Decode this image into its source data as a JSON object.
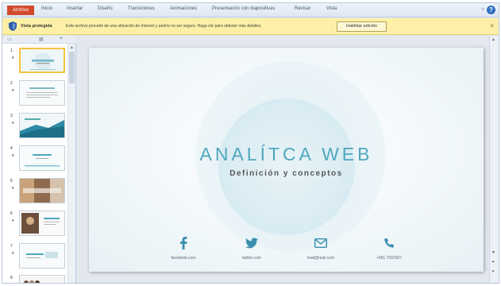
{
  "ribbon": {
    "file_tab": "Archivo",
    "tabs": [
      "Inicio",
      "Insertar",
      "Diseño",
      "Transiciones",
      "Animaciones",
      "Presentación con diapositivas",
      "Revisar",
      "Vista"
    ]
  },
  "protected_view": {
    "title": "Vista protegida",
    "message": "Este archivo procede de una ubicación de Internet y podría no ser seguro. Haga clic para obtener más detalles.",
    "button_label": "Habilitar edición"
  },
  "thumbnails": {
    "slide_numbers": [
      "1",
      "2",
      "3",
      "4",
      "5",
      "6",
      "7",
      "8"
    ]
  },
  "slide": {
    "title": "ANALÍTCA WEB",
    "subtitle": "Definición y conceptos",
    "contacts": [
      {
        "icon": "facebook-icon",
        "label": "facebook.com"
      },
      {
        "icon": "twitter-icon",
        "label": "twitter.com"
      },
      {
        "icon": "mail-icon",
        "label": "mail@mail.com"
      },
      {
        "icon": "phone-icon",
        "label": "+591 7097607"
      }
    ]
  },
  "colors": {
    "accent": "#4fa7bd",
    "file_tab": "#d24a2c",
    "warning_bar": "#fdf0a6"
  }
}
